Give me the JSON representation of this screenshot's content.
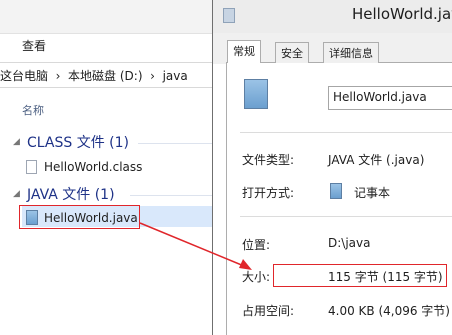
{
  "explorer": {
    "view_tab": "查看",
    "address": "这台电脑  ›  本地磁盘 (D:)  ›  java",
    "column_name": "名称",
    "groups": [
      {
        "title": "CLASS 文件 (1)",
        "files": [
          "HelloWorld.class"
        ]
      },
      {
        "title": "JAVA 文件 (1)",
        "files": [
          "HelloWorld.java"
        ]
      }
    ]
  },
  "properties": {
    "window_title": "HelloWorld.java",
    "tabs": [
      "常规",
      "安全",
      "详细信息"
    ],
    "file_name": "HelloWorld.java",
    "rows": {
      "type_label": "文件类型:",
      "type_value": "JAVA 文件 (.java)",
      "opens_label": "打开方式:",
      "opens_value": "记事本",
      "location_label": "位置:",
      "location_value": "D:\\java",
      "size_label": "大小:",
      "size_value": "115 字节 (115 字节)",
      "disk_label": "占用空间:",
      "disk_value": "4.00 KB (4,096 字节)"
    }
  },
  "colors": {
    "annotation": "#e0262b",
    "group_title": "#1e3287",
    "selection": "#d9e8fb"
  },
  "icons": [
    "folder-chevron-icon",
    "file-icon",
    "java-file-icon",
    "notepad-icon"
  ]
}
